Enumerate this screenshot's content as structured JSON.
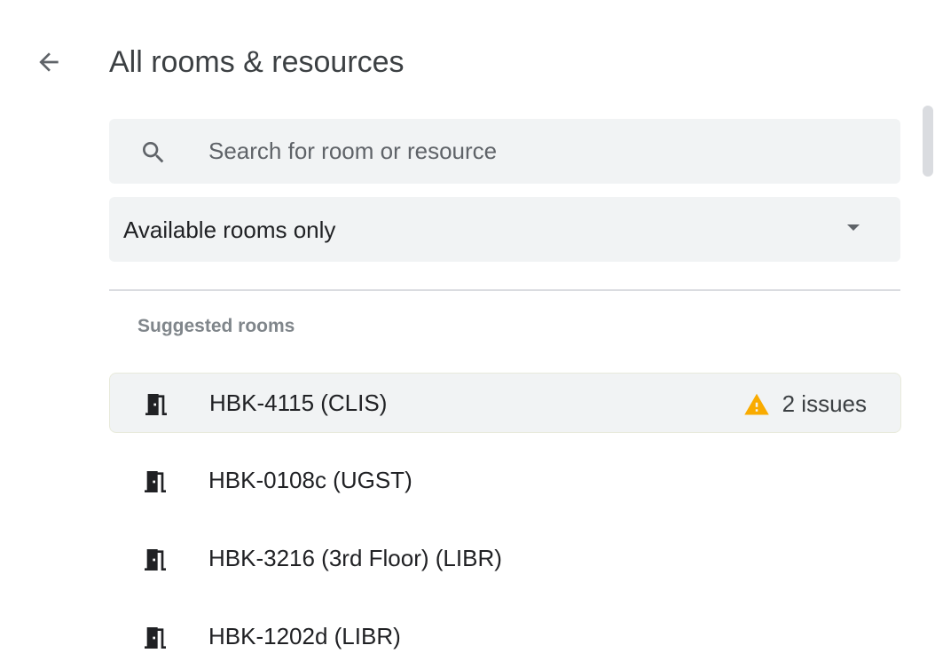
{
  "header": {
    "title": "All rooms & resources"
  },
  "search": {
    "placeholder": "Search for room or resource",
    "value": ""
  },
  "filter": {
    "selected": "Available rooms only"
  },
  "suggested": {
    "label": "Suggested rooms",
    "rooms": [
      {
        "name": "HBK-4115 (CLIS)",
        "issues": "2 issues"
      },
      {
        "name": "HBK-0108c (UGST)"
      },
      {
        "name": "HBK-3216 (3rd Floor) (LIBR)"
      },
      {
        "name": "HBK-1202d (LIBR)"
      }
    ]
  },
  "colors": {
    "warning": "#f9ab00",
    "field_background": "#f1f3f4",
    "text": "#202124"
  }
}
